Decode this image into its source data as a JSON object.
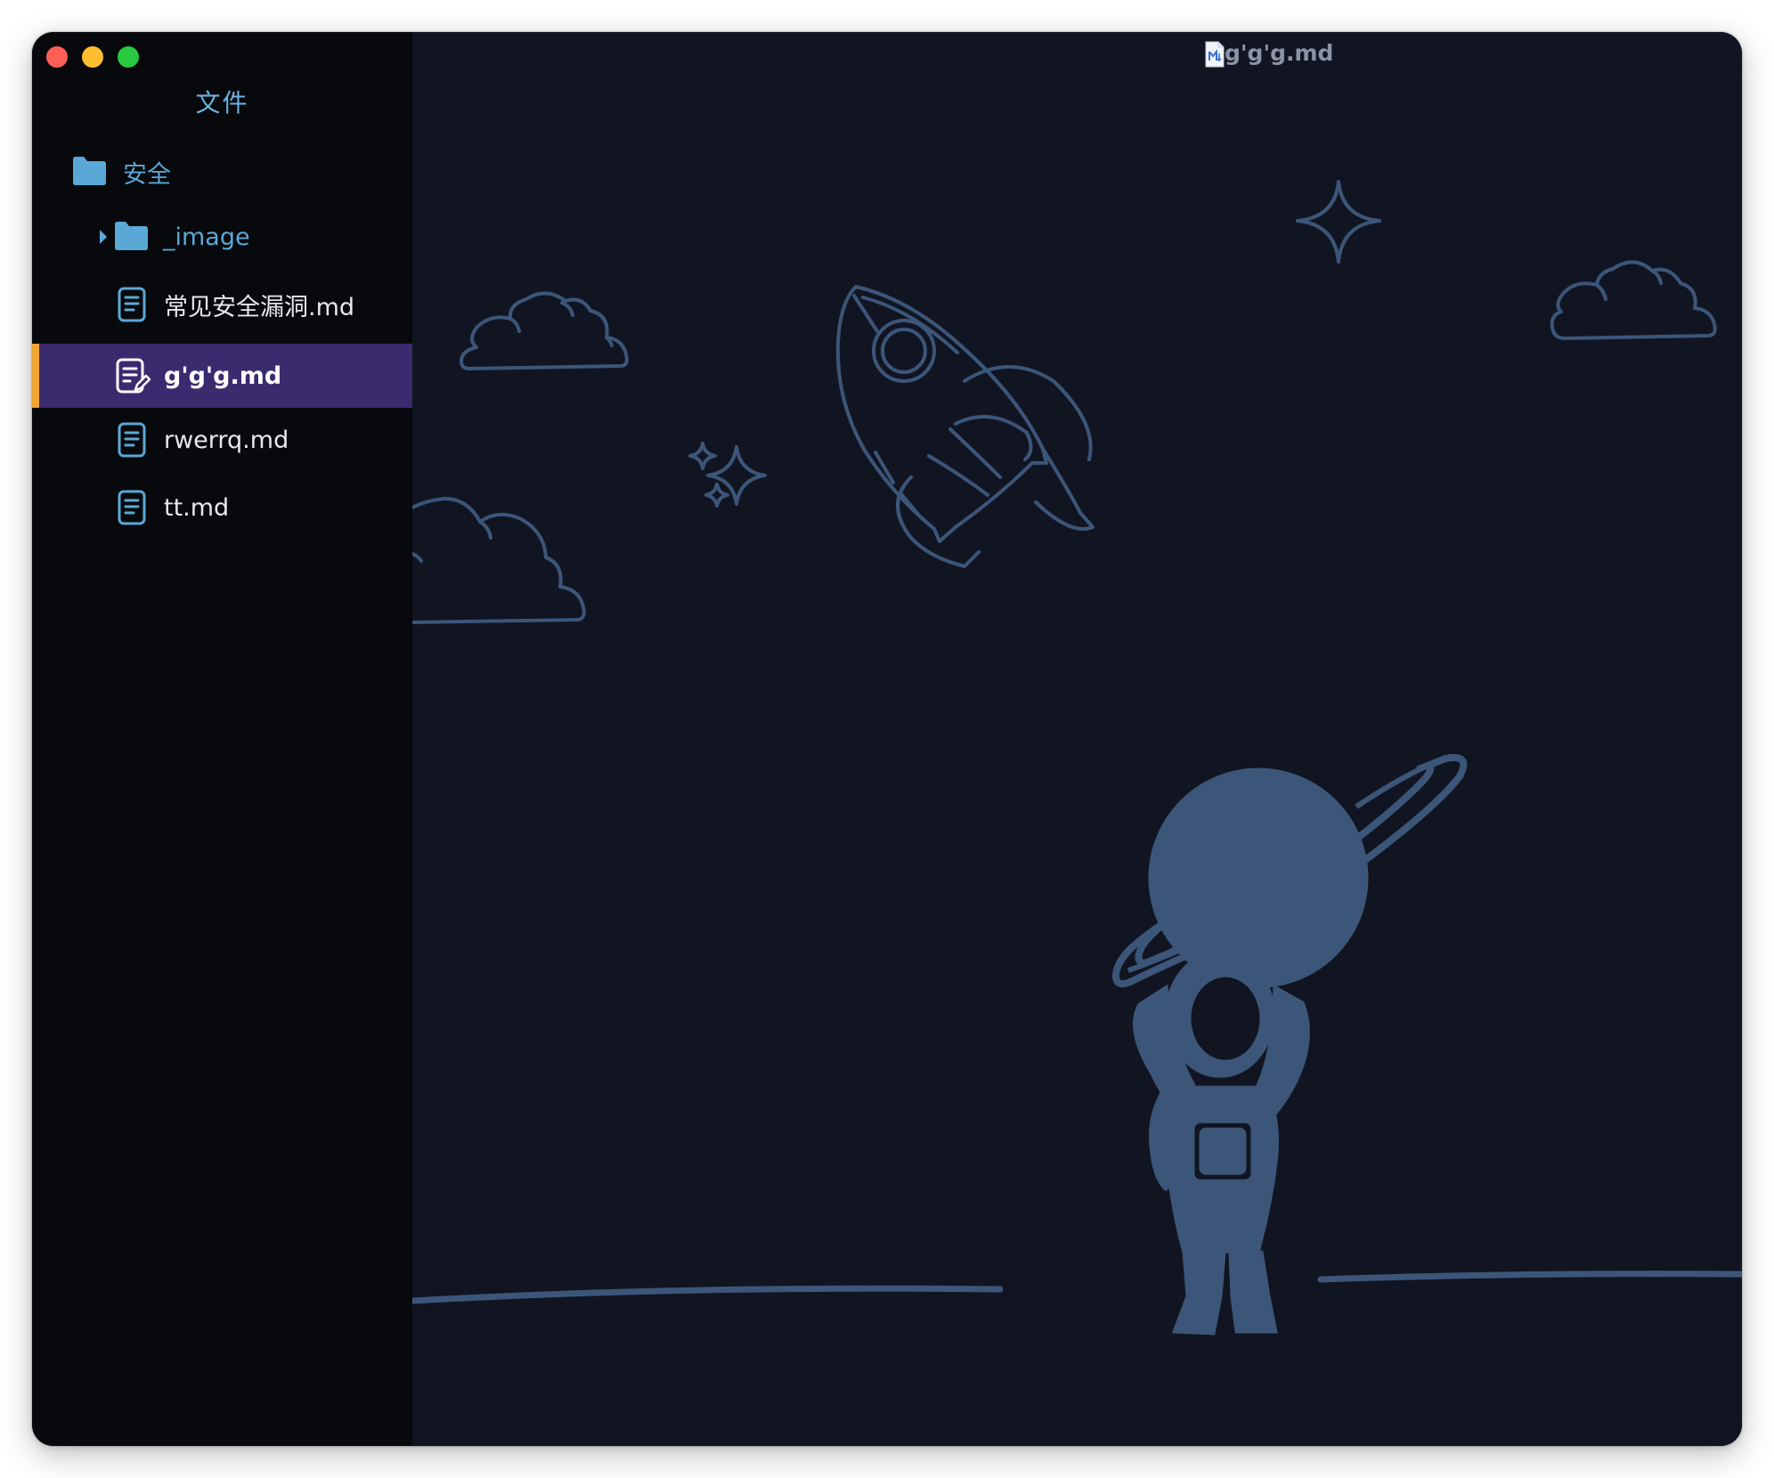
{
  "window": {
    "title": "g'g'g.md"
  },
  "sidebar": {
    "title": "文件",
    "items": [
      {
        "label": "安全",
        "type": "folder"
      },
      {
        "label": "_image",
        "type": "folder"
      },
      {
        "label": "常见安全漏洞.md",
        "type": "file"
      },
      {
        "label": "g'g'g.md",
        "type": "file",
        "selected": true
      },
      {
        "label": "rwerrq.md",
        "type": "file"
      },
      {
        "label": "tt.md",
        "type": "file"
      }
    ]
  },
  "colors": {
    "sidebar_bg": "#08090c",
    "main_bg": "#111522",
    "folder_blue": "#5aa8d6",
    "selected_bg": "#3a2a6e",
    "selected_accent": "#f0a431",
    "illustration": "#3c5679"
  },
  "icons": {
    "folder": "folder-icon",
    "file": "document-icon",
    "file_editing": "document-edit-icon",
    "expand": "caret-right-icon",
    "markdown": "markdown-file-icon"
  }
}
